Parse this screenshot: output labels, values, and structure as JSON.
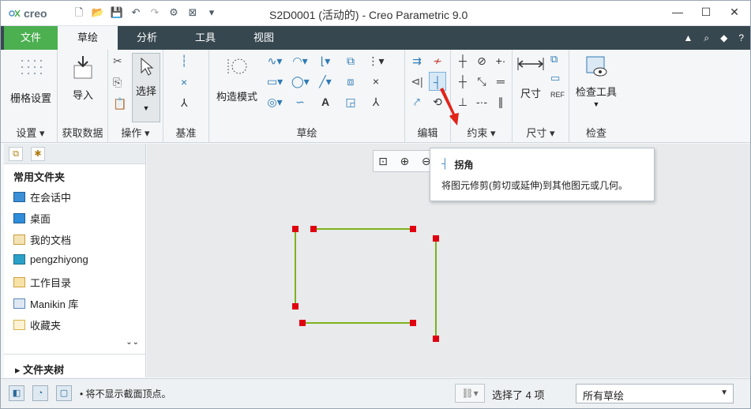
{
  "titlebar": {
    "logo_text": "creo",
    "title": "S2D0001 (活动的) - Creo Parametric 9.0",
    "qat_icons": [
      "new-icon",
      "open-icon",
      "save-icon",
      "undo-icon",
      "redo-icon",
      "regenerate-icon",
      "close-window-icon",
      "customize-icon"
    ],
    "win_min": "—",
    "win_max": "☐",
    "win_close": "✕"
  },
  "tabs": {
    "file": "文件",
    "sketch": "草绘",
    "analysis": "分析",
    "tools": "工具",
    "view": "视图"
  },
  "ribbon": {
    "setup": {
      "grid_label": "栅格设置",
      "group_label": "设置"
    },
    "getdata": {
      "import_label": "导入",
      "group_label": "获取数据"
    },
    "operations": {
      "select_label": "选择",
      "group_label": "操作"
    },
    "datum": {
      "group_label": "基准"
    },
    "sketching": {
      "construct_label": "构造模式",
      "group_label": "草绘"
    },
    "editing": {
      "group_label": "编辑"
    },
    "constrain": {
      "group_label": "约束"
    },
    "dimension": {
      "dim_label": "尺寸",
      "group_label": "尺寸"
    },
    "inspect": {
      "inspect_label": "检查工具",
      "group_label": "检查"
    }
  },
  "tooltip": {
    "title": "拐角",
    "description": "将图元修剪(剪切或延伸)到其他图元或几何。"
  },
  "folders": {
    "section_title": "常用文件夹",
    "items": [
      {
        "label": "在会话中",
        "color": "#3a8fd6"
      },
      {
        "label": "桌面",
        "color": "#2f8dd9"
      },
      {
        "label": "我的文档",
        "color": "#d9a441"
      },
      {
        "label": "pengzhiyong",
        "color": "#2aa0c8"
      },
      {
        "label": "工作目录",
        "color": "#e2b24a"
      },
      {
        "label": "Manikin 库",
        "color": "#5b87b8"
      },
      {
        "label": "收藏夹",
        "color": "#d9b04b"
      }
    ],
    "footer": "文件夹树"
  },
  "status": {
    "message": "• 将不显示截面顶点。",
    "selected": "选择了 4 项",
    "filter": "所有草绘"
  },
  "colors": {
    "sketch_line": "#7cb21b",
    "vertex": "#e0000f",
    "tab_bar": "#37474f",
    "file_tab": "#4caf50"
  }
}
